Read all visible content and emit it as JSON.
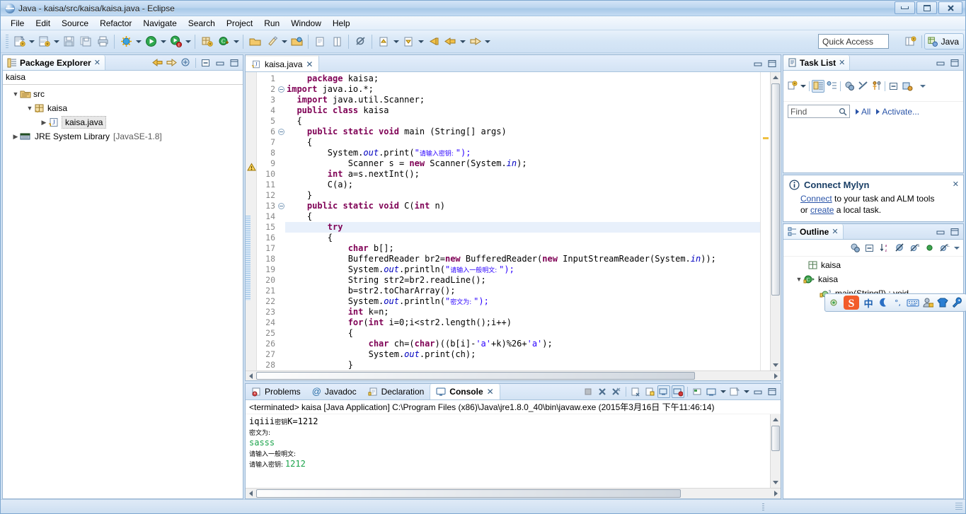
{
  "window": {
    "title": "Java - kaisa/src/kaisa/kaisa.java - Eclipse",
    "app_icon": "eclipse-icon",
    "buttons": {
      "minimize": "minimize-button",
      "maximize": "maximize-button",
      "close": "close-button"
    }
  },
  "menubar": {
    "items": [
      {
        "label": "File"
      },
      {
        "label": "Edit"
      },
      {
        "label": "Source"
      },
      {
        "label": "Refactor"
      },
      {
        "label": "Navigate"
      },
      {
        "label": "Search"
      },
      {
        "label": "Project"
      },
      {
        "label": "Run"
      },
      {
        "label": "Window"
      },
      {
        "label": "Help"
      }
    ]
  },
  "toolbar": {
    "quick_access_placeholder": "Quick Access",
    "perspective_label": "Java",
    "icons": [
      "new-wizard-icon",
      "new-java-project-icon",
      "save-icon",
      "save-all-icon",
      "print-icon",
      "debug-icon",
      "run-icon",
      "run-coverage-icon",
      "new-java-package-icon",
      "new-java-class-icon",
      "open-type-icon",
      "search-icon",
      "open-task-icon",
      "toggle-mark-occurrences-icon",
      "skip-all-breakpoints-icon",
      "next-annotation-icon",
      "previous-annotation-icon",
      "last-edit-location-icon",
      "back-icon",
      "forward-icon"
    ]
  },
  "package_explorer": {
    "title": "Package Explorer",
    "filter_text": "kaisa",
    "toolbar_icons": [
      "back-icon",
      "forward-icon",
      "link-with-editor-icon",
      "collapse-all-icon",
      "minimize-icon",
      "maximize-icon"
    ],
    "tree": [
      {
        "label": "src",
        "icon": "source-folder-icon",
        "indent": 1,
        "twisty": "expanded",
        "selected": false
      },
      {
        "label": "kaisa",
        "icon": "package-icon",
        "indent": 2,
        "twisty": "expanded",
        "selected": false
      },
      {
        "label": "kaisa.java",
        "icon": "java-file-icon",
        "indent": 3,
        "twisty": "collapsed",
        "selected": true
      },
      {
        "label": "JRE System Library",
        "sub": "[JavaSE-1.8]",
        "icon": "library-icon",
        "indent": 1,
        "twisty": "collapsed",
        "selected": false
      }
    ]
  },
  "editor": {
    "tab_label": "kaisa.java",
    "tab_icon": "java-file-icon",
    "tab_close": "close-icon",
    "toolbar_icons": [
      "minimize-icon",
      "maximize-icon"
    ],
    "highlighted_line": 15,
    "warning_line": 9,
    "fold_lines": [
      2,
      6,
      13
    ],
    "changed_bar_lines": [
      13,
      14,
      15,
      16,
      17,
      18,
      19,
      20,
      21,
      22,
      23,
      24,
      25,
      26,
      27,
      28
    ],
    "lines": [
      {
        "n": 1,
        "segs": [
          {
            "t": "    ",
            "c": ""
          },
          {
            "t": "package",
            "c": "kw"
          },
          {
            "t": " kaisa;",
            "c": ""
          }
        ]
      },
      {
        "n": 2,
        "segs": [
          {
            "t": "",
            "c": ""
          },
          {
            "t": "import",
            "c": "kw"
          },
          {
            "t": " java.io.*;",
            "c": ""
          }
        ]
      },
      {
        "n": 3,
        "segs": [
          {
            "t": "  ",
            "c": ""
          },
          {
            "t": "import",
            "c": "kw"
          },
          {
            "t": " java.util.Scanner;",
            "c": ""
          }
        ]
      },
      {
        "n": 4,
        "segs": [
          {
            "t": "  ",
            "c": ""
          },
          {
            "t": "public class",
            "c": "kw"
          },
          {
            "t": " kaisa",
            "c": ""
          }
        ]
      },
      {
        "n": 5,
        "segs": [
          {
            "t": "  {",
            "c": ""
          }
        ]
      },
      {
        "n": 6,
        "segs": [
          {
            "t": "    ",
            "c": ""
          },
          {
            "t": "public static void",
            "c": "kw"
          },
          {
            "t": " main (String[] args)",
            "c": ""
          }
        ]
      },
      {
        "n": 7,
        "segs": [
          {
            "t": "    {",
            "c": ""
          }
        ]
      },
      {
        "n": 8,
        "segs": [
          {
            "t": "        System.",
            "c": ""
          },
          {
            "t": "out",
            "c": "fld"
          },
          {
            "t": ".print(",
            "c": ""
          },
          {
            "t": "\"",
            "c": "str"
          },
          {
            "t": "请输入密钥: ",
            "c": "cjk"
          },
          {
            "t": "\");",
            "c": "str"
          }
        ]
      },
      {
        "n": 9,
        "segs": [
          {
            "t": "            Scanner s = ",
            "c": ""
          },
          {
            "t": "new",
            "c": "kw"
          },
          {
            "t": " Scanner(System.",
            "c": ""
          },
          {
            "t": "in",
            "c": "fld"
          },
          {
            "t": ");",
            "c": ""
          }
        ]
      },
      {
        "n": 10,
        "segs": [
          {
            "t": "        ",
            "c": ""
          },
          {
            "t": "int",
            "c": "kw"
          },
          {
            "t": " a=s.nextInt();",
            "c": ""
          }
        ]
      },
      {
        "n": 11,
        "segs": [
          {
            "t": "        C(a);",
            "c": ""
          }
        ]
      },
      {
        "n": 12,
        "segs": [
          {
            "t": "    }",
            "c": ""
          }
        ]
      },
      {
        "n": 13,
        "segs": [
          {
            "t": "    ",
            "c": ""
          },
          {
            "t": "public static void",
            "c": "kw"
          },
          {
            "t": " C(",
            "c": ""
          },
          {
            "t": "int",
            "c": "kw"
          },
          {
            "t": " n)",
            "c": ""
          }
        ]
      },
      {
        "n": 14,
        "segs": [
          {
            "t": "    {",
            "c": ""
          }
        ]
      },
      {
        "n": 15,
        "segs": [
          {
            "t": "        ",
            "c": ""
          },
          {
            "t": "try",
            "c": "kw"
          }
        ]
      },
      {
        "n": 16,
        "segs": [
          {
            "t": "        {",
            "c": ""
          }
        ]
      },
      {
        "n": 17,
        "segs": [
          {
            "t": "            ",
            "c": ""
          },
          {
            "t": "char",
            "c": "kw"
          },
          {
            "t": " b[];",
            "c": ""
          }
        ]
      },
      {
        "n": 18,
        "segs": [
          {
            "t": "            BufferedReader br2=",
            "c": ""
          },
          {
            "t": "new",
            "c": "kw"
          },
          {
            "t": " BufferedReader(",
            "c": ""
          },
          {
            "t": "new",
            "c": "kw"
          },
          {
            "t": " InputStreamReader(System.",
            "c": ""
          },
          {
            "t": "in",
            "c": "fld"
          },
          {
            "t": "));",
            "c": ""
          }
        ]
      },
      {
        "n": 19,
        "segs": [
          {
            "t": "            System.",
            "c": ""
          },
          {
            "t": "out",
            "c": "fld"
          },
          {
            "t": ".println(",
            "c": ""
          },
          {
            "t": "\"",
            "c": "str"
          },
          {
            "t": "请输入一般明文: ",
            "c": "cjk"
          },
          {
            "t": "\");",
            "c": "str"
          }
        ]
      },
      {
        "n": 20,
        "segs": [
          {
            "t": "            String str2=br2.readLine();",
            "c": ""
          }
        ]
      },
      {
        "n": 21,
        "segs": [
          {
            "t": "            b=str2.toCharArray();",
            "c": ""
          }
        ]
      },
      {
        "n": 22,
        "segs": [
          {
            "t": "            System.",
            "c": ""
          },
          {
            "t": "out",
            "c": "fld"
          },
          {
            "t": ".println(",
            "c": ""
          },
          {
            "t": "\"",
            "c": "str"
          },
          {
            "t": "密文为: ",
            "c": "cjk"
          },
          {
            "t": "\");",
            "c": "str"
          }
        ]
      },
      {
        "n": 23,
        "segs": [
          {
            "t": "            ",
            "c": ""
          },
          {
            "t": "int",
            "c": "kw"
          },
          {
            "t": " k=n;",
            "c": ""
          }
        ]
      },
      {
        "n": 24,
        "segs": [
          {
            "t": "            ",
            "c": ""
          },
          {
            "t": "for",
            "c": "kw"
          },
          {
            "t": "(",
            "c": ""
          },
          {
            "t": "int",
            "c": "kw"
          },
          {
            "t": " i=0;i<str2.length();i++)",
            "c": ""
          }
        ]
      },
      {
        "n": 25,
        "segs": [
          {
            "t": "            {",
            "c": ""
          }
        ]
      },
      {
        "n": 26,
        "segs": [
          {
            "t": "                ",
            "c": ""
          },
          {
            "t": "char",
            "c": "kw"
          },
          {
            "t": " ch=(",
            "c": ""
          },
          {
            "t": "char",
            "c": "kw"
          },
          {
            "t": ")((b[i]-",
            "c": ""
          },
          {
            "t": "'a'",
            "c": "str"
          },
          {
            "t": "+k)%26+",
            "c": ""
          },
          {
            "t": "'a'",
            "c": "str"
          },
          {
            "t": ");",
            "c": ""
          }
        ]
      },
      {
        "n": 27,
        "segs": [
          {
            "t": "                System.",
            "c": ""
          },
          {
            "t": "out",
            "c": "fld"
          },
          {
            "t": ".print(ch);",
            "c": ""
          }
        ]
      },
      {
        "n": 28,
        "segs": [
          {
            "t": "            }",
            "c": ""
          }
        ]
      }
    ]
  },
  "task_list": {
    "title": "Task List",
    "close_icon": "close-icon",
    "toolbar_icons": [
      "new-task-icon",
      "dropdown-icon",
      "categorized-icon",
      "scheduled-icon",
      "synchronize-icon",
      "delete-icon",
      "focus-on-workweek-icon",
      "collapse-all-icon",
      "restore-icon"
    ],
    "find_placeholder": "Find",
    "find_icon": "search-icon",
    "links": [
      {
        "label": "All"
      },
      {
        "label": "Activate..."
      }
    ],
    "window_icons": [
      "minimize-icon",
      "maximize-icon"
    ]
  },
  "mylyn": {
    "title": "Connect Mylyn",
    "info_icon": "info-icon",
    "close_icon": "close-icon",
    "line1_prefix": "",
    "connect_link": "Connect",
    "line1_rest": " to your task and ALM tools",
    "line2_prefix": "or ",
    "create_link": "create",
    "line2_rest": " a local task."
  },
  "outline": {
    "title": "Outline",
    "close_icon": "close-icon",
    "toolbar_icons": [
      "focus-on-active-task-icon",
      "collapse-all-icon",
      "sort-icon",
      "hide-fields-icon",
      "hide-static-icon",
      "hide-non-public-icon",
      "hide-local-types-icon",
      "view-menu-icon"
    ],
    "window_icons": [
      "minimize-icon",
      "maximize-icon"
    ],
    "tree": [
      {
        "label": "kaisa",
        "icon": "package-icon",
        "indent": 1,
        "twisty": ""
      },
      {
        "label": "kaisa",
        "icon": "class-icon",
        "indent": 1,
        "twisty": "expanded"
      },
      {
        "label": "main(String[]) : void",
        "icon": "method-static-icon",
        "indent": 2,
        "twisty": ""
      }
    ]
  },
  "console": {
    "tabs": [
      {
        "label": "Problems",
        "icon": "problems-icon",
        "active": false
      },
      {
        "label": "Javadoc",
        "icon": "javadoc-icon",
        "active": false
      },
      {
        "label": "Declaration",
        "icon": "declaration-icon",
        "active": false
      },
      {
        "label": "Console",
        "icon": "console-icon",
        "active": true,
        "close_icon": "close-icon"
      }
    ],
    "toolbar_icons": [
      "terminate-icon",
      "remove-launch-icon",
      "remove-all-terminated-icon",
      "clear-console-icon",
      "scroll-lock-icon",
      "show-console-on-output-icon",
      "pin-console-icon",
      "display-selected-console-icon",
      "open-console-icon",
      "dropdown-icon",
      "minimize-icon",
      "maximize-icon"
    ],
    "header": "<terminated> kaisa [Java Application] C:\\Program Files (x86)\\Java\\jre1.8.0_40\\bin\\javaw.exe (2015年3月16日 下午11:46:14)",
    "output": [
      {
        "segs": [
          {
            "t": "请输入密钥: ",
            "c": "cjk"
          },
          {
            "t": "1212",
            "c": "in"
          }
        ]
      },
      {
        "segs": [
          {
            "t": "请输入一般明文:",
            "c": "cjk"
          }
        ]
      },
      {
        "segs": [
          {
            "t": "sasss",
            "c": "in"
          }
        ]
      },
      {
        "segs": [
          {
            "t": "密文为:",
            "c": "cjk"
          }
        ]
      },
      {
        "segs": [
          {
            "t": "iqiii",
            "c": ""
          },
          {
            "t": "密钥",
            "c": "cjk"
          },
          {
            "t": "K=1212",
            "c": ""
          }
        ]
      }
    ]
  },
  "ime": {
    "name": "sogou-input-method",
    "items": [
      "sogou-logo-icon",
      "chinese-mode-icon",
      "moon-icon",
      "punctuation-icon",
      "soft-keyboard-icon",
      "user-icon",
      "skin-icon",
      "toolbox-icon"
    ]
  },
  "colors": {
    "keyword": "#7f0055",
    "string": "#2a00ff",
    "field": "#0000c0",
    "link": "#2a54a8",
    "console_input": "#1aa34a",
    "highlight_line": "#e8f0fb"
  }
}
